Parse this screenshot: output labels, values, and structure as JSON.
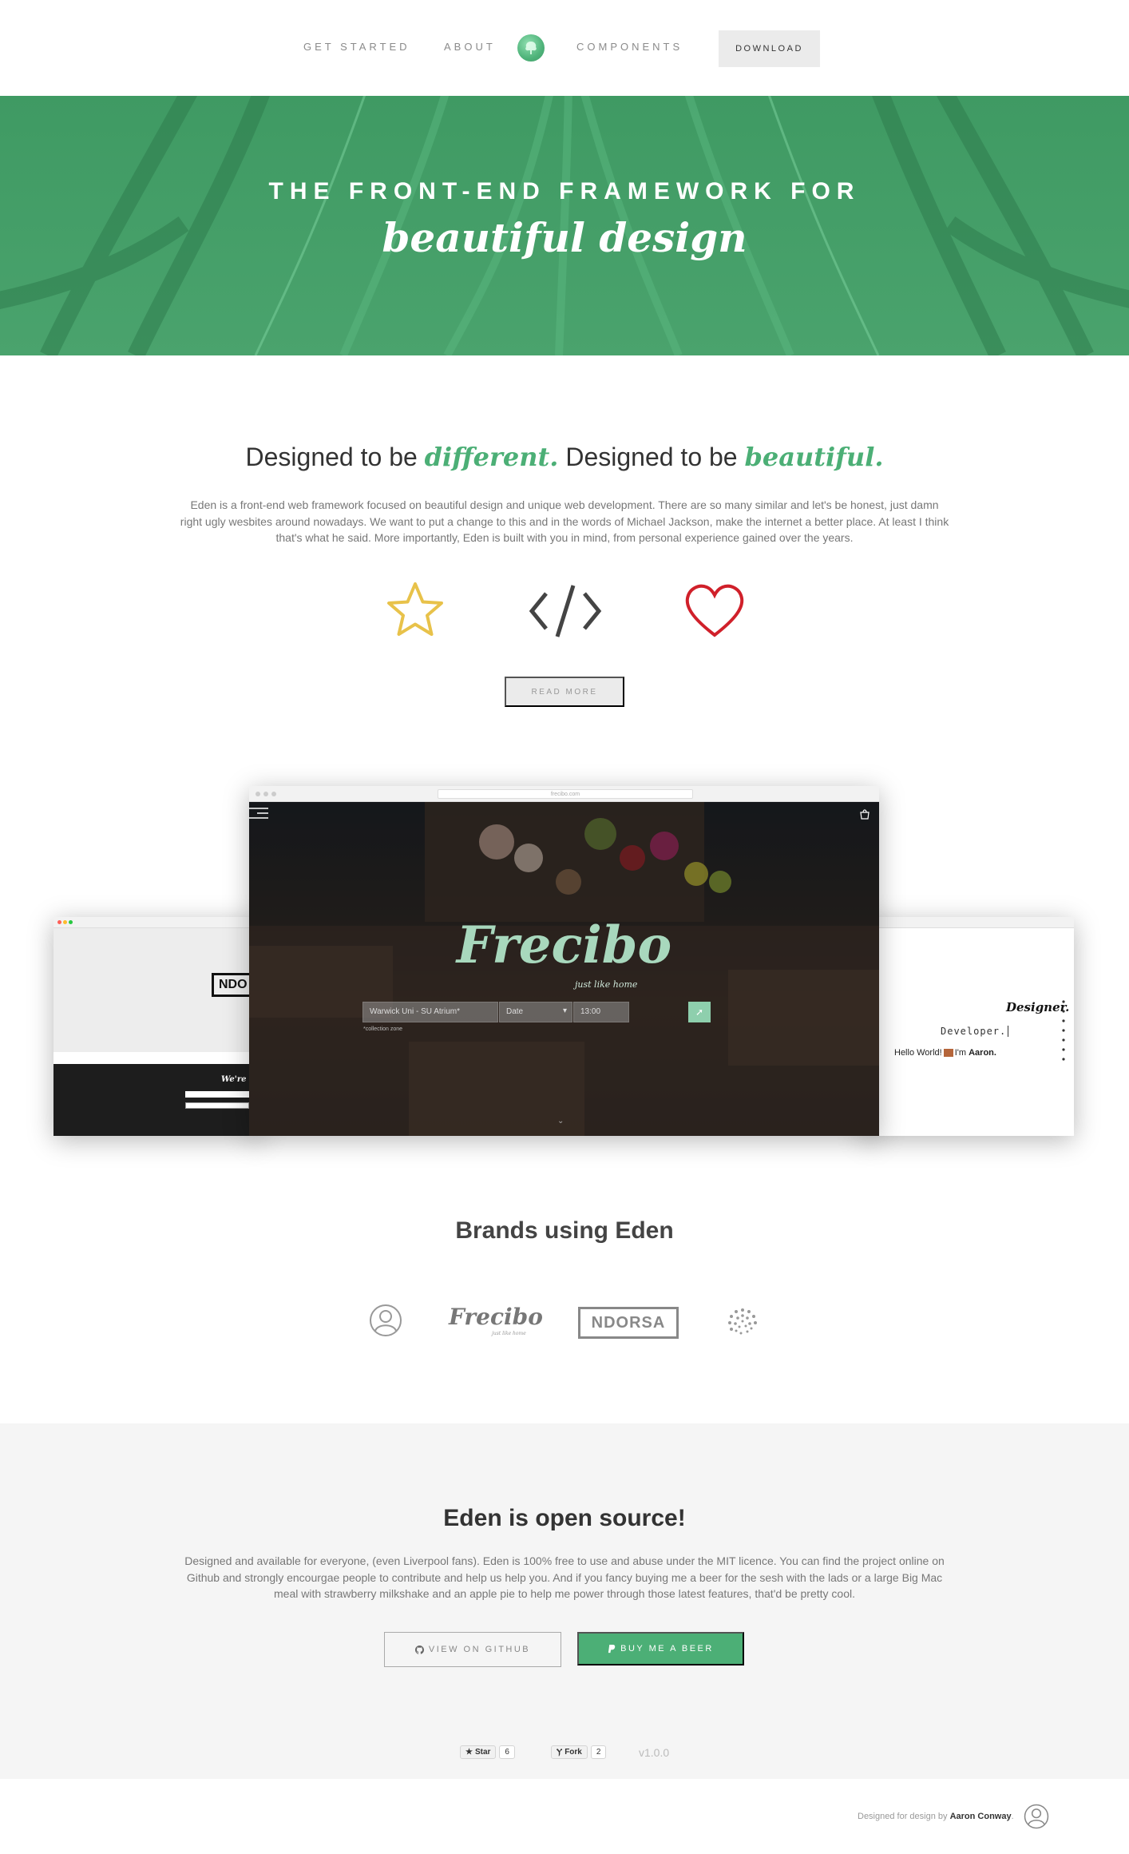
{
  "nav": {
    "get_started": "GET STARTED",
    "about": "ABOUT",
    "components": "COMPONENTS",
    "download": "DOWNLOAD",
    "logo_icon": "tree-icon"
  },
  "hero": {
    "title": "THE FRONT-END FRAMEWORK FOR",
    "script": "beautiful design"
  },
  "intro": {
    "title_pre": "Designed to be ",
    "title_word1": "different.",
    "title_mid": " Designed to be ",
    "title_word2": "beautiful.",
    "text": "Eden is a front-end web framework focused on beautiful design and unique web development. There are so many similar and let's be honest, just damn right ugly wesbites around nowadays. We want to put a change to this and in the words of Michael Jackson, make the internet a better place. At least I think that's what he said. More importantly, Eden is built with you in mind, from personal experience gained over the years.",
    "features": [
      "star-icon",
      "code-icon",
      "heart-icon"
    ],
    "read_more": "READ MORE"
  },
  "showcase": {
    "frecibo": {
      "logo": "Frecibo",
      "tagline": "just like home",
      "field_location": "Warwick Uni - SU Atrium*",
      "field_date": "Date",
      "field_time": "13:00",
      "note": "*collection zone",
      "url": "frecibo.com"
    },
    "left": {
      "logo": "NDO",
      "tagline": "We're al"
    },
    "right": {
      "title": "Designer.",
      "typed": "Developer.",
      "greeting_pre": "Hello World!",
      "greeting_post": "I'm",
      "name": "Aaron."
    }
  },
  "brands": {
    "title": "Brands using Eden",
    "items": [
      {
        "name": "avatar-logo"
      },
      {
        "name": "Frecibo",
        "tagline": "just like home"
      },
      {
        "name": "NDORSA"
      },
      {
        "name": "dots-logo"
      }
    ]
  },
  "opensource": {
    "title": "Eden is open source!",
    "text": "Designed and available for everyone, (even Liverpool fans). Eden is 100% free to use and abuse under the MIT licence. You can find the project online on Github and strongly encourgae people to contribute and help us help you. And if you fancy buying me a beer for the sesh with the lads or a large Big Mac meal with strawberry milkshake and an apple pie to help me power through those latest features, that'd be pretty cool.",
    "github_label": "VIEW ON GITHUB",
    "beer_label": "BUY ME A BEER",
    "star_label": "Star",
    "star_count": "6",
    "fork_label": "Fork",
    "fork_count": "2",
    "version": "v1.0.0"
  },
  "footer": {
    "credit_pre": "Designed for design by ",
    "credit_name": "Aaron Conway",
    "credit_post": "."
  },
  "colors": {
    "accent": "#4caf76",
    "hero": "#479e69",
    "star": "#e8c24a",
    "heart": "#d0202a",
    "code": "#444444"
  }
}
